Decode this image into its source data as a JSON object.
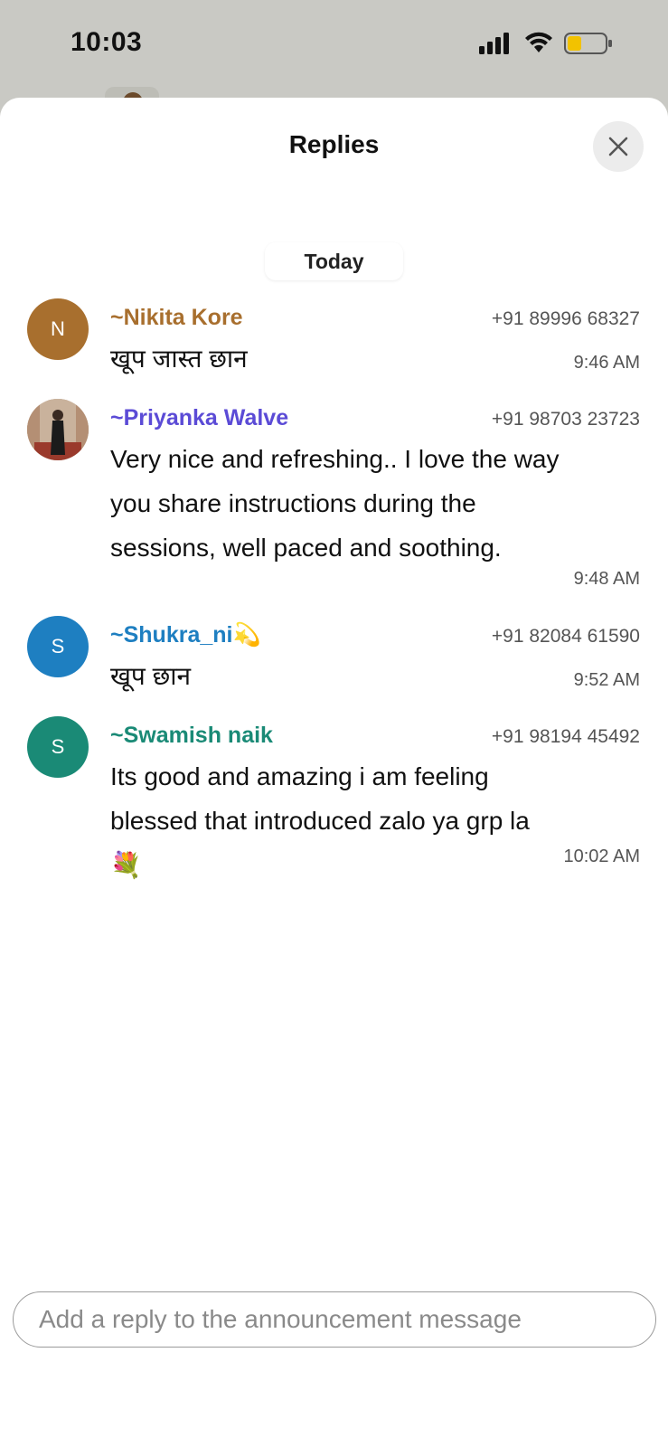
{
  "status_bar": {
    "time": "10:03"
  },
  "sheet": {
    "title": "Replies",
    "date_separator": "Today"
  },
  "replies": [
    {
      "avatar_letter": "N",
      "avatar_color": "#a86f2e",
      "name": "~Nikita Kore",
      "name_color": "#a86f2e",
      "phone": "+91 89996 68327",
      "message": "खूप जास्त छान",
      "time": "9:46 AM"
    },
    {
      "avatar_letter": "",
      "avatar_color": "#b99e86",
      "name": "~Priyanka Walve",
      "name_color": "#5b4bd6",
      "phone": "+91 98703 23723",
      "message_lines": [
        "Very nice and refreshing.. I love the way",
        "you share instructions during the",
        "sessions, well paced and soothing."
      ],
      "time": "9:48 AM"
    },
    {
      "avatar_letter": "S",
      "avatar_color": "#1e7fc1",
      "name": "~Shukra_ni",
      "name_emoji": "💫",
      "name_color": "#1e7fc1",
      "phone": "+91 82084 61590",
      "message": "खूप छान",
      "time": "9:52 AM"
    },
    {
      "avatar_letter": "S",
      "avatar_color": "#1a8a76",
      "name": "~Swamish naik",
      "name_color": "#1a8a76",
      "phone": "+91 98194 45492",
      "message_lines": [
        "Its good and amazing i am feeling",
        "blessed that introduced zalo ya grp la",
        "💐"
      ],
      "time": "10:02 AM"
    }
  ],
  "composer": {
    "placeholder": "Add a reply to the announcement message"
  },
  "icons": {
    "close": "close-icon",
    "signal": "signal-icon",
    "wifi": "wifi-icon",
    "battery": "battery-icon"
  }
}
